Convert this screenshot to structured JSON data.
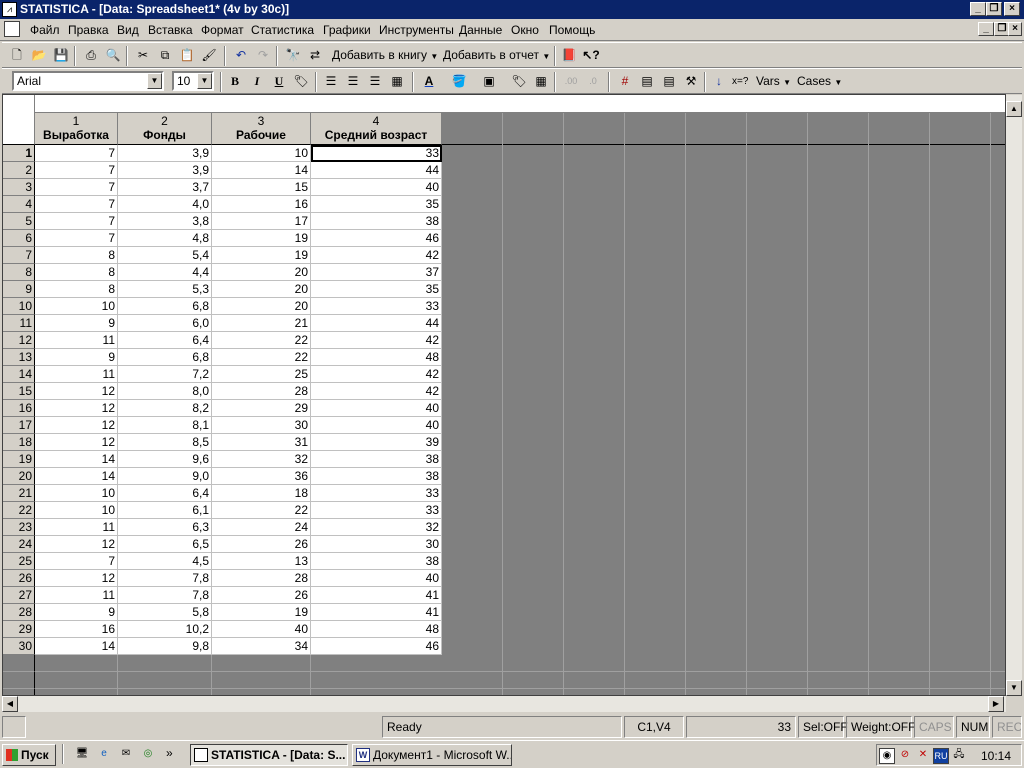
{
  "window": {
    "title": "STATISTICA - [Data: Spreadsheet1* (4v by 30c)]",
    "app_icon": "statistica-icon"
  },
  "menu": [
    "Файл",
    "Правка",
    "Вид",
    "Вставка",
    "Формат",
    "Статистика",
    "Графики",
    "Инструменты",
    "Данные",
    "Окно",
    "Помощь"
  ],
  "toolbar": {
    "add_to_workbook": "Добавить в книгу",
    "add_to_report": "Добавить в отчет",
    "font_name": "Arial",
    "font_size": "10",
    "bold": "B",
    "italic": "I",
    "underline": "U",
    "vars": "Vars",
    "cases": "Cases",
    "eq_label": "x=?"
  },
  "spreadsheet": {
    "columns": [
      {
        "num": "1",
        "name": "Выработка"
      },
      {
        "num": "2",
        "name": "Фонды"
      },
      {
        "num": "3",
        "name": "Рабочие"
      },
      {
        "num": "4",
        "name": "Средний возраст"
      }
    ],
    "rows": [
      [
        "1",
        "7",
        "3,9",
        "10",
        "33"
      ],
      [
        "2",
        "7",
        "3,9",
        "14",
        "44"
      ],
      [
        "3",
        "7",
        "3,7",
        "15",
        "40"
      ],
      [
        "4",
        "7",
        "4,0",
        "16",
        "35"
      ],
      [
        "5",
        "7",
        "3,8",
        "17",
        "38"
      ],
      [
        "6",
        "7",
        "4,8",
        "19",
        "46"
      ],
      [
        "7",
        "8",
        "5,4",
        "19",
        "42"
      ],
      [
        "8",
        "8",
        "4,4",
        "20",
        "37"
      ],
      [
        "9",
        "8",
        "5,3",
        "20",
        "35"
      ],
      [
        "10",
        "10",
        "6,8",
        "20",
        "33"
      ],
      [
        "11",
        "9",
        "6,0",
        "21",
        "44"
      ],
      [
        "12",
        "11",
        "6,4",
        "22",
        "42"
      ],
      [
        "13",
        "9",
        "6,8",
        "22",
        "48"
      ],
      [
        "14",
        "11",
        "7,2",
        "25",
        "42"
      ],
      [
        "15",
        "12",
        "8,0",
        "28",
        "42"
      ],
      [
        "16",
        "12",
        "8,2",
        "29",
        "40"
      ],
      [
        "17",
        "12",
        "8,1",
        "30",
        "40"
      ],
      [
        "18",
        "12",
        "8,5",
        "31",
        "39"
      ],
      [
        "19",
        "14",
        "9,6",
        "32",
        "38"
      ],
      [
        "20",
        "14",
        "9,0",
        "36",
        "38"
      ],
      [
        "21",
        "10",
        "6,4",
        "18",
        "33"
      ],
      [
        "22",
        "10",
        "6,1",
        "22",
        "33"
      ],
      [
        "23",
        "11",
        "6,3",
        "24",
        "32"
      ],
      [
        "24",
        "12",
        "6,5",
        "26",
        "30"
      ],
      [
        "25",
        "7",
        "4,5",
        "13",
        "38"
      ],
      [
        "26",
        "12",
        "7,8",
        "28",
        "40"
      ],
      [
        "27",
        "11",
        "7,8",
        "26",
        "41"
      ],
      [
        "28",
        "9",
        "5,8",
        "19",
        "41"
      ],
      [
        "29",
        "16",
        "10,2",
        "40",
        "48"
      ],
      [
        "30",
        "14",
        "9,8",
        "34",
        "46"
      ]
    ],
    "selected_cell": {
      "row": 1,
      "col": 4
    }
  },
  "status": {
    "ready": "Ready",
    "cell_ref": "C1,V4",
    "cell_value": "33",
    "sel": "Sel:OFF",
    "weight": "Weight:OFF",
    "caps": "CAPS",
    "num": "NUM",
    "rec": "REC"
  },
  "taskbar": {
    "start": "Пуск",
    "task1": "STATISTICA - [Data: S...",
    "task2": "Документ1 - Microsoft W...",
    "lang": "RU",
    "clock": "10:14",
    "quick_more": "»"
  },
  "colors": {
    "titlebar": "#0a246a",
    "sheet_bg": "#808080",
    "chrome": "#d4d0c8"
  }
}
